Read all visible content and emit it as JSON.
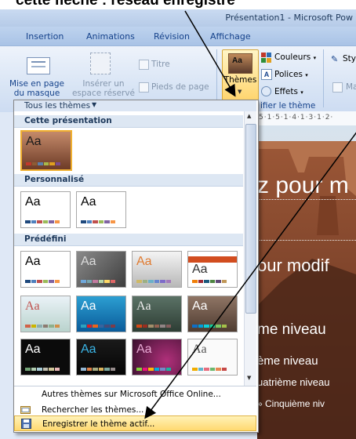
{
  "caption": "cette flèche : réseau enregistré",
  "window_title": "Présentation1 - Microsoft Pow",
  "tabs": [
    "Insertion",
    "Animations",
    "Révision",
    "Affichage"
  ],
  "ribbon": {
    "layout_master_line1": "Mise en page",
    "layout_master_line2": "du masque",
    "insert_placeholder_line1": "Insérer un",
    "insert_placeholder_line2": "espace réservé",
    "title_check": "Titre",
    "footers_check": "Pieds de page",
    "themes_button": "Thèmes",
    "colors": "Couleurs",
    "fonts": "Polices",
    "effects": "Effets",
    "edit_theme_group": "ifier le thème",
    "styles_partial": "Sty",
    "ma_partial": "Ma"
  },
  "ruler_text": "5·1·5·1·4·1·3·1·2·",
  "panel": {
    "all_themes": "Tous les thèmes",
    "sections": {
      "this_presentation": "Cette présentation",
      "custom": "Personnalisé",
      "builtin": "Prédéfini"
    },
    "thumb_label": "Aa",
    "menu": {
      "more_online": "Autres thèmes sur Microsoft Office Online...",
      "browse": "Rechercher les thèmes...",
      "save": "Enregistrer le thème actif..."
    }
  },
  "slide": {
    "line1": "z pour m",
    "line2": "our modif",
    "line3": "me niveau",
    "line4": "ème niveau",
    "line5": "uatrième niveau",
    "line6": "» Cinquième niv"
  },
  "colors": {
    "ribbon_text": "#15428b",
    "hover_highlight": "#ffe38c",
    "selection_border": "#f0b030"
  }
}
